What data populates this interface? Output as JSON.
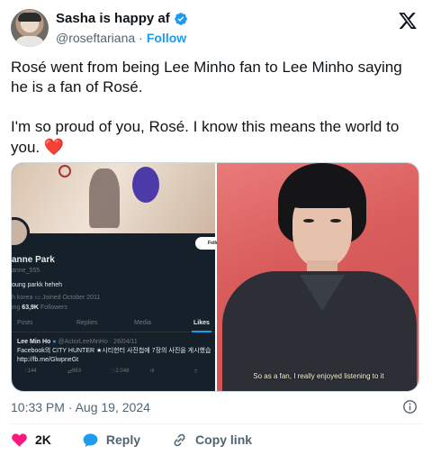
{
  "author": {
    "display_name": "Sasha is happy af",
    "handle": "@roseftariana",
    "separator": "·",
    "follow_label": "Follow"
  },
  "tweet": {
    "paragraph1": "Rosé went from being Lee Minho fan to Lee Minho saying he is a fan of Rosé.",
    "paragraph2": "I'm so proud of you, Rosé. I know this means the world to you.",
    "emoji": "❤️",
    "timestamp": "10:33 PM · Aug 19, 2024"
  },
  "media": {
    "left": {
      "follow_pill": "Follo",
      "profile_name": "anne Park",
      "profile_handle": "anne_555",
      "bio": "oung parkk heheh",
      "meta_location": "h korea",
      "meta_joined": "Joined October 2011",
      "followers_prefix": "ing",
      "followers_count": "63,9K",
      "followers_label": "Followers",
      "tabs": [
        "Posts",
        "Replies",
        "Media",
        "Likes"
      ],
      "embedded_author": "Lee Min Ho",
      "embedded_handle_date": "@ActorLeeMinHo · 26/04/11",
      "embedded_line1": "Facebook의 CITY HUNTER ★시티헌터 사진첩에 7장의 사진을 게시했습",
      "embedded_line2": "http://fb.me/GlwpneGt",
      "embedded_stats": [
        "144",
        "963",
        "2.048"
      ]
    },
    "right": {
      "caption": "So as a fan, I really enjoyed listening to it"
    }
  },
  "actions": {
    "like_count": "2K",
    "reply_label": "Reply",
    "copy_label": "Copy link"
  },
  "colors": {
    "accent": "#1d9bf0",
    "like": "#f91880",
    "text": "#0f1419",
    "muted": "#536471"
  }
}
